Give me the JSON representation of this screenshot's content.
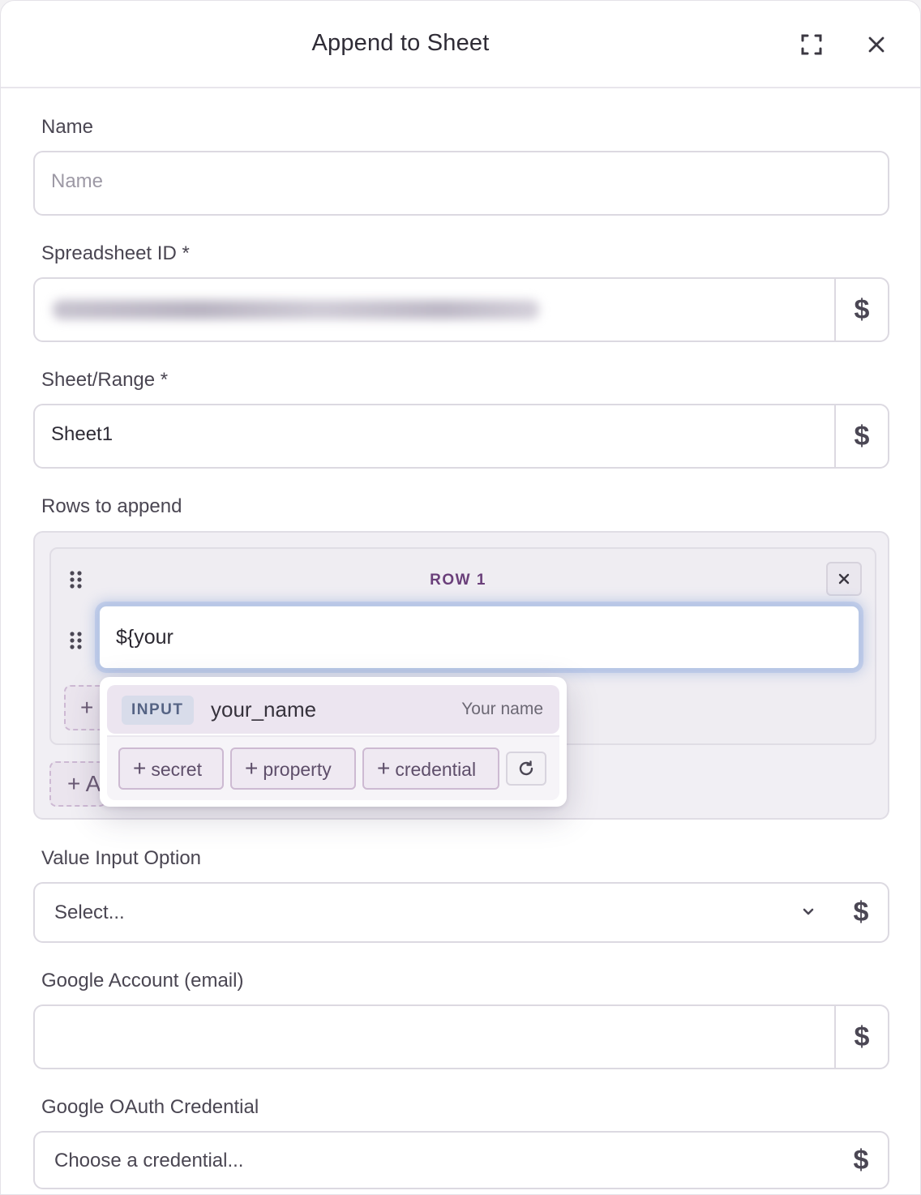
{
  "modal": {
    "title": "Append to Sheet",
    "expand_icon": "expand-icon",
    "close_icon": "close-icon"
  },
  "fields": {
    "name": {
      "label": "Name",
      "placeholder": "Name",
      "value": ""
    },
    "spreadsheet_id": {
      "label": "Spreadsheet ID *",
      "value_state": "blurred",
      "dollar": "$"
    },
    "sheet_range": {
      "label": "Sheet/Range *",
      "value": "Sheet1",
      "dollar": "$"
    },
    "rows": {
      "label": "Rows to append",
      "row_title": "ROW 1",
      "cell_value": "${your",
      "add_cell_label": "+",
      "add_row_label": "+ A"
    },
    "value_input_option": {
      "label": "Value Input Option",
      "selected": "Select...",
      "dollar": "$"
    },
    "google_account": {
      "label": "Google Account (email)",
      "value": "",
      "dollar": "$"
    },
    "oauth_credential": {
      "label": "Google OAuth Credential",
      "selected": "Choose a credential...",
      "dollar": "$"
    }
  },
  "autocomplete": {
    "suggestion": {
      "badge": "INPUT",
      "name": "your_name",
      "description": "Your name"
    },
    "chips": [
      {
        "plus": "+",
        "label": "secret"
      },
      {
        "plus": "+",
        "label": "property"
      },
      {
        "plus": "+",
        "label": "credential"
      }
    ],
    "refresh_icon": "refresh-icon"
  },
  "colors": {
    "accent_purple": "#6a3f7a",
    "focus_blue": "#96b0e2",
    "border": "#dcd9e1"
  }
}
